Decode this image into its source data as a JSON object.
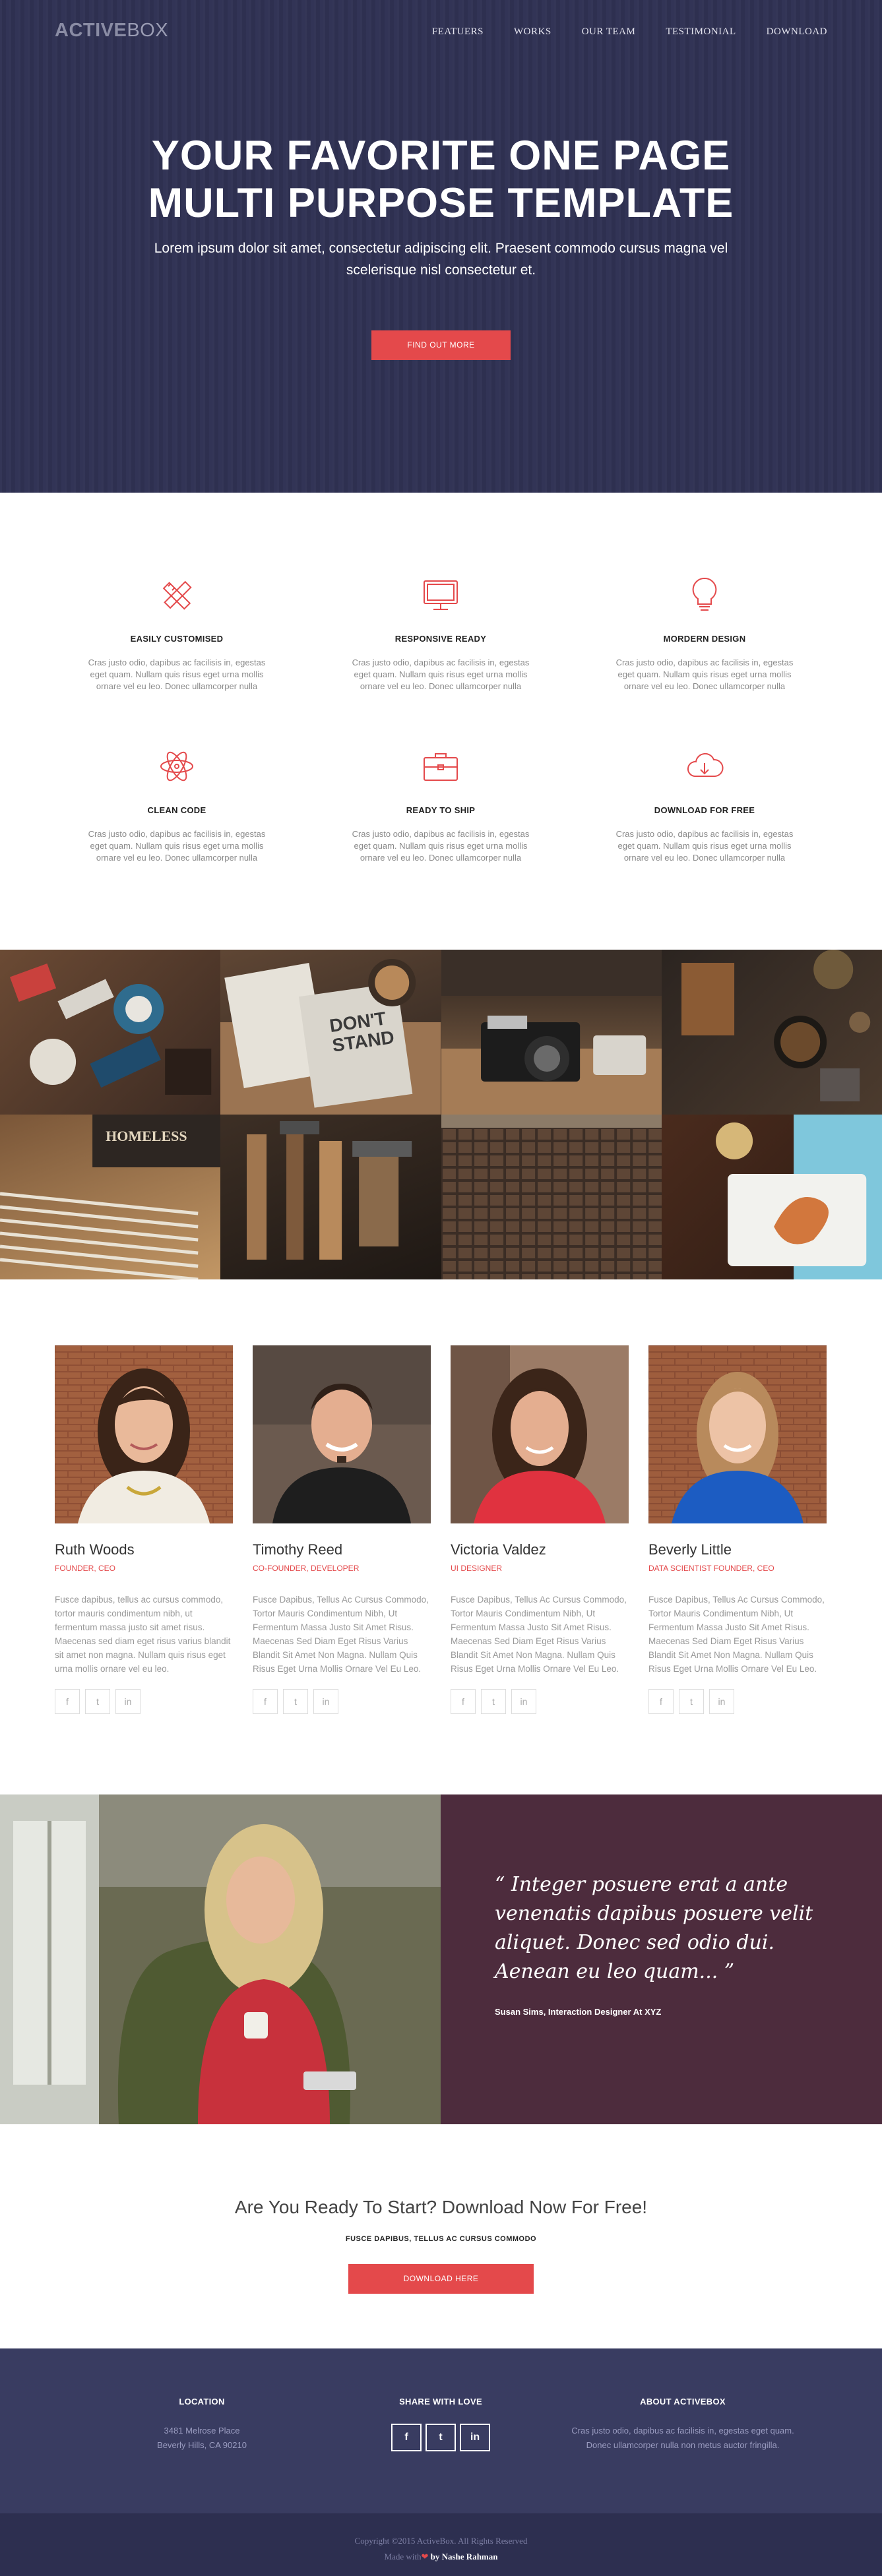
{
  "brand": {
    "bold": "ACTIVE",
    "light": "BOX"
  },
  "nav": {
    "items": [
      "FEATUERS",
      "WORKS",
      "OUR TEAM",
      "TESTIMONIAL",
      "DOWNLOAD"
    ]
  },
  "hero": {
    "title_line1": "YOUR FAVORITE ONE PAGE",
    "title_line2": "MULTI PURPOSE TEMPLATE",
    "subtitle": "Lorem ipsum dolor sit amet, consectetur adipiscing elit. Praesent commodo cursus magna vel scelerisque nisl consectetur et.",
    "button": "FIND OUT MORE"
  },
  "features": [
    {
      "icon": "pencil-ruler-icon",
      "title": "EASILY CUSTOMISED",
      "text": "Cras justo odio, dapibus ac facilisis in, egestas eget quam. Nullam quis risus eget urna mollis ornare vel eu leo. Donec ullamcorper nulla"
    },
    {
      "icon": "monitor-icon",
      "title": "RESPONSIVE READY",
      "text": "Cras justo odio, dapibus ac facilisis in, egestas eget quam. Nullam quis risus eget urna mollis ornare vel eu leo. Donec ullamcorper nulla"
    },
    {
      "icon": "lightbulb-icon",
      "title": "MORDERN DESIGN",
      "text": "Cras justo odio, dapibus ac facilisis in, egestas eget quam. Nullam quis risus eget urna mollis ornare vel eu leo. Donec ullamcorper nulla"
    },
    {
      "icon": "atom-icon",
      "title": "CLEAN CODE",
      "text": "Cras justo odio, dapibus ac facilisis in, egestas eget quam. Nullam quis risus eget urna mollis ornare vel eu leo. Donec ullamcorper nulla"
    },
    {
      "icon": "briefcase-icon",
      "title": "READY TO SHIP",
      "text": "Cras justo odio, dapibus ac facilisis in, egestas eget quam. Nullam quis risus eget urna mollis ornare vel eu leo. Donec ullamcorper nulla"
    },
    {
      "icon": "cloud-download-icon",
      "title": "DOWNLOAD FOR FREE",
      "text": "Cras justo odio, dapibus ac facilisis in, egestas eget quam. Nullam quis risus eget urna mollis ornare vel eu leo. Donec ullamcorper nulla"
    }
  ],
  "team": [
    {
      "name": "Ruth Woods",
      "role": "FOUNDER, CEO",
      "bio": "Fusce dapibus, tellus ac cursus commodo, tortor mauris condimentum nibh, ut fermentum massa justo sit amet risus. Maecenas sed diam eget risus varius blandit sit amet non magna. Nullam quis risus eget urna mollis ornare vel eu leo."
    },
    {
      "name": "Timothy Reed",
      "role": "CO-FOUNDER, DEVELOPER",
      "bio": "Fusce Dapibus, Tellus Ac Cursus Commodo, Tortor Mauris Condimentum Nibh, Ut Fermentum Massa Justo Sit Amet Risus. Maecenas Sed Diam Eget Risus Varius Blandit Sit Amet Non Magna. Nullam Quis Risus Eget Urna Mollis Ornare Vel Eu Leo."
    },
    {
      "name": "Victoria Valdez",
      "role": "UI DESIGNER",
      "bio": "Fusce Dapibus, Tellus Ac Cursus Commodo, Tortor Mauris Condimentum Nibh, Ut Fermentum Massa Justo Sit Amet Risus. Maecenas Sed Diam Eget Risus Varius Blandit Sit Amet Non Magna. Nullam Quis Risus Eget Urna Mollis Ornare Vel Eu Leo."
    },
    {
      "name": "Beverly Little",
      "role": "DATA SCIENTIST FOUNDER, CEO",
      "bio": "Fusce Dapibus, Tellus Ac Cursus Commodo, Tortor Mauris Condimentum Nibh, Ut Fermentum Massa Justo Sit Amet Risus. Maecenas Sed Diam Eget Risus Varius Blandit Sit Amet Non Magna. Nullam Quis Risus Eget Urna Mollis Ornare Vel Eu Leo."
    }
  ],
  "social_glyphs": {
    "facebook": "f",
    "twitter": "t",
    "linkedin": "in"
  },
  "testimonial": {
    "quote": "“ Integer posuere erat a ante venenatis dapibus posuere velit aliquet. Donec sed odio dui. Aenean eu leo quam... ”",
    "author": "Susan Sims, Interaction Designer At XYZ"
  },
  "cta": {
    "title": "Are You Ready To Start? Download Now For Free!",
    "subtitle": "FUSCE DAPIBUS, TELLUS AC CURSUS COMMODO",
    "button": "DOWNLOAD HERE"
  },
  "footer": {
    "location_title": "LOCATION",
    "address_line1": "3481 Melrose Place",
    "address_line2": "Beverly Hills, CA 90210",
    "share_title": "SHARE WITH LOVE",
    "about_title": "ABOUT ACTIVEBOX",
    "about_text": "Cras justo odio, dapibus ac facilisis in, egestas eget quam. Donec ullamcorper nulla non metus auctor fringilla.",
    "copyright": "Copyright ©2015 ActiveBox. All Rights Reserved",
    "made_with": "Made with",
    "heart": "❤",
    "author": "by Nashe Rahman"
  },
  "colors": {
    "navy": "#2f3153",
    "accent": "#e4494b",
    "plum": "#4d2c3d",
    "footer": "#393c61"
  }
}
